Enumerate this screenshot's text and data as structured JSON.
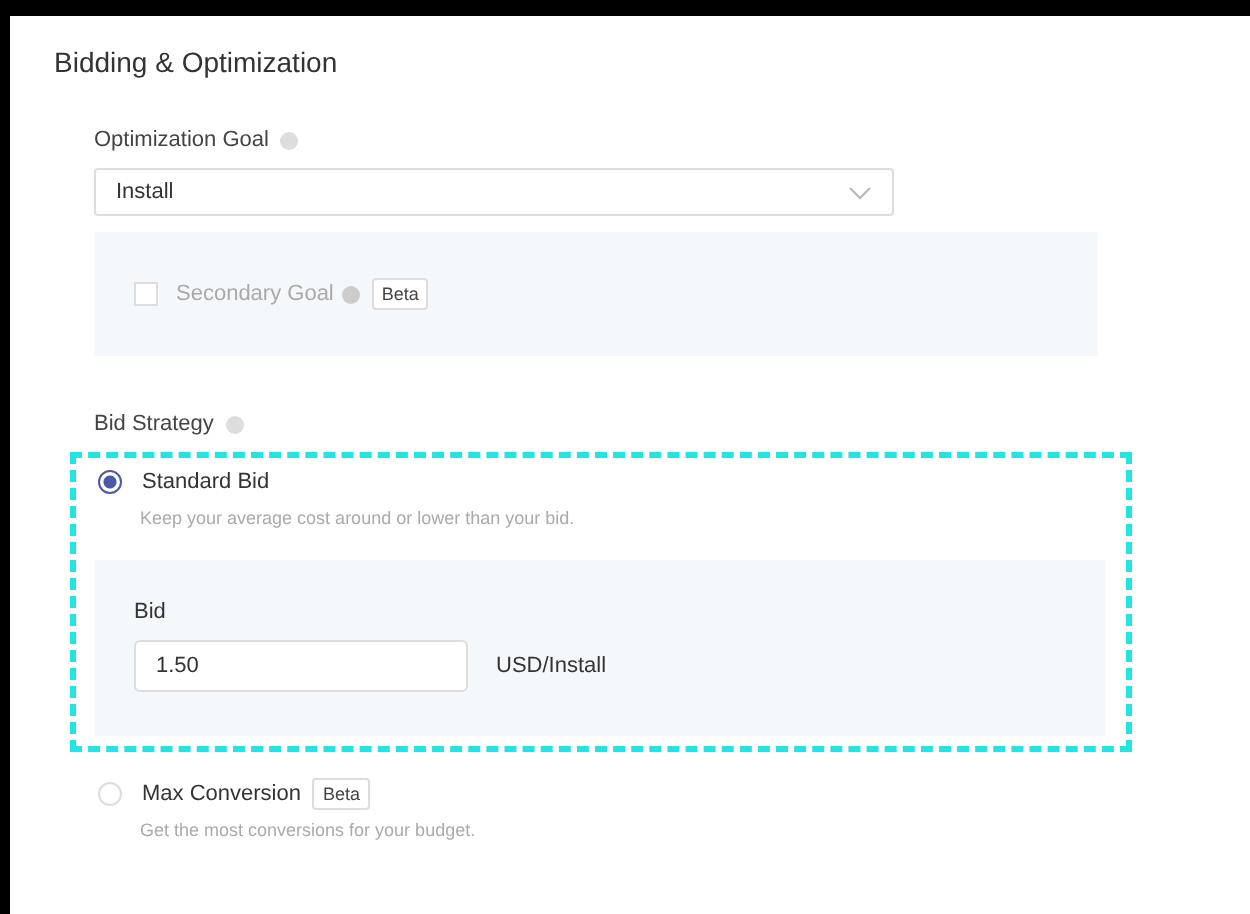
{
  "section": {
    "title": "Bidding & Optimization"
  },
  "optimization_goal": {
    "label": "Optimization Goal",
    "value": "Install"
  },
  "secondary_goal": {
    "label": "Secondary Goal",
    "badge": "Beta",
    "checked": false,
    "disabled": true
  },
  "bid_strategy": {
    "label": "Bid Strategy",
    "options": [
      {
        "label": "Standard Bid",
        "description": "Keep your average cost around or lower than your bid.",
        "selected": true,
        "highlighted": true,
        "bid": {
          "label": "Bid",
          "value": "1.50",
          "unit": "USD/Install"
        }
      },
      {
        "label": "Max Conversion",
        "badge": "Beta",
        "description": "Get the most conversions for your budget.",
        "selected": false,
        "highlighted": false
      }
    ]
  }
}
